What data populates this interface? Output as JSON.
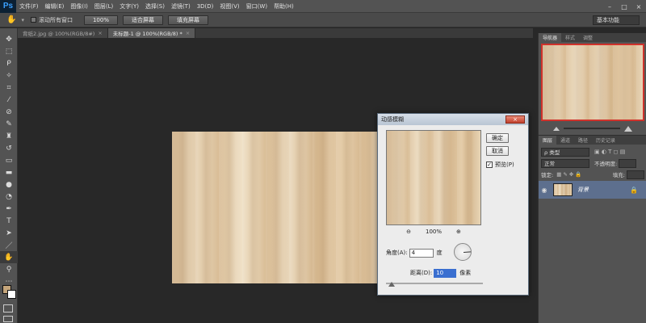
{
  "app": {
    "logo": "Ps"
  },
  "menu": [
    "文件(F)",
    "编辑(E)",
    "图像(I)",
    "图层(L)",
    "文字(Y)",
    "选择(S)",
    "滤镜(T)",
    "3D(D)",
    "视图(V)",
    "窗口(W)",
    "帮助(H)"
  ],
  "window_controls": {
    "minimize": "–",
    "maximize": "□",
    "close": "×"
  },
  "options": {
    "scroll_all_label": "滚动所有窗口",
    "zoom_100": "100%",
    "fit_screen": "适合屏幕",
    "fill_screen": "填充屏幕",
    "workspace": "基本功能"
  },
  "tabs": [
    {
      "label": "背纸2.jpg @ 100%(RGB/8#)",
      "close": "×"
    },
    {
      "label": "未标题-1 @ 100%(RGB/8) *",
      "close": "×"
    }
  ],
  "toolbar": [
    "move-icon",
    "marquee-icon",
    "lasso-icon",
    "magic-wand-icon",
    "crop-icon",
    "eyedropper-icon",
    "healing-icon",
    "brush-icon",
    "stamp-icon",
    "history-brush-icon",
    "eraser-icon",
    "gradient-icon",
    "blur-icon",
    "dodge-icon",
    "pen-icon",
    "type-icon",
    "path-select-icon",
    "shape-icon",
    "hand-icon",
    "zoom-icon"
  ],
  "colors": {
    "foreground": "#c4a57b",
    "background": "#ffffff",
    "nav_frame": "#d0322b",
    "accent": "#3a6fd0"
  },
  "navigator": {
    "tabs": [
      "导航器",
      "样式",
      "调整"
    ]
  },
  "layers": {
    "tabs": [
      "图层",
      "通道",
      "路径",
      "历史记录"
    ],
    "filter_label": "ρ 类型",
    "blend_mode": "正常",
    "opacity_label": "不透明度:",
    "lock_label": "锁定:",
    "fill_label": "填充:",
    "layer_name": "背景"
  },
  "dialog": {
    "title": "动感模糊",
    "close": "×",
    "ok": "确定",
    "cancel": "取消",
    "preview_label": "预览(P)",
    "preview_checked": "✓",
    "zoom_out": "⊖",
    "zoom_level": "100%",
    "zoom_in": "⊕",
    "angle_label": "角度(A):",
    "angle_value": "4",
    "angle_unit": "度",
    "distance_label": "距离(D):",
    "distance_value": "10",
    "distance_unit": "像素"
  }
}
